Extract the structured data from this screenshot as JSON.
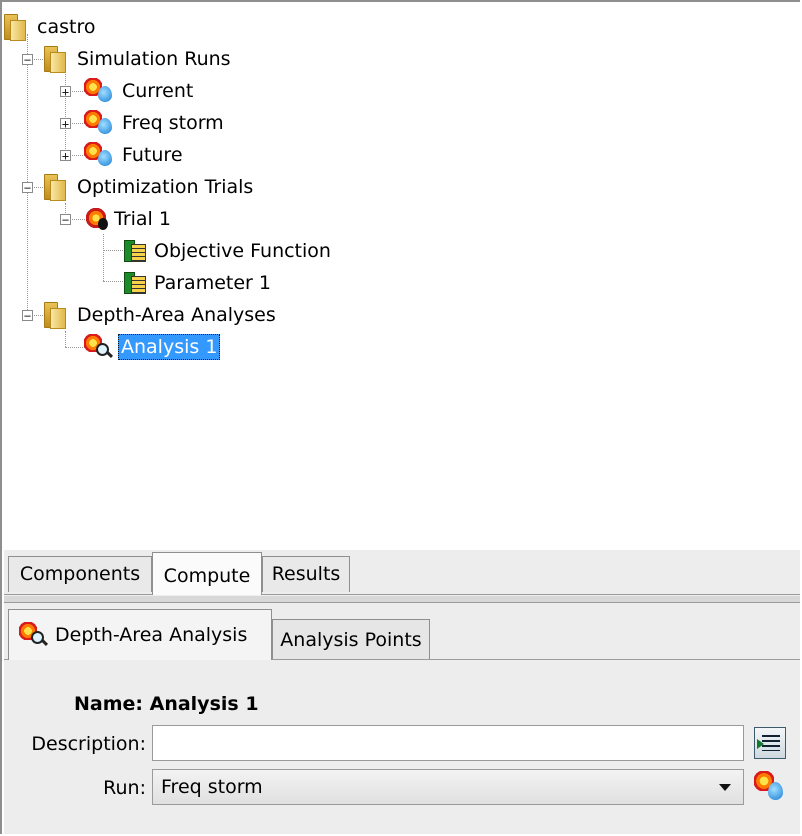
{
  "tree": {
    "root": {
      "label": "castro"
    },
    "simulation_runs": {
      "label": "Simulation Runs",
      "items": [
        {
          "label": "Current"
        },
        {
          "label": "Freq storm"
        },
        {
          "label": "Future"
        }
      ]
    },
    "optimization_trials": {
      "label": "Optimization Trials",
      "trial": {
        "label": "Trial 1",
        "children": [
          {
            "label": "Objective Function"
          },
          {
            "label": "Parameter 1"
          }
        ]
      }
    },
    "depth_area_analyses": {
      "label": "Depth-Area Analyses",
      "items": [
        {
          "label": "Analysis 1",
          "selected": true
        }
      ]
    },
    "expander_collapsed": "+",
    "expander_expanded": "−"
  },
  "tabs": [
    {
      "label": "Components",
      "active": false
    },
    {
      "label": "Compute",
      "active": true
    },
    {
      "label": "Results",
      "active": false
    }
  ],
  "property_tabs": [
    {
      "label": "Depth-Area Analysis",
      "active": true,
      "icon": "depth-area-analysis-icon"
    },
    {
      "label": "Analysis Points",
      "active": false
    }
  ],
  "form": {
    "name_label": "Name: Analysis 1",
    "description_label": "Description:",
    "description_value": "",
    "run_label": "Run:",
    "run_value": "Freq storm"
  },
  "colors": {
    "selection": "#3399ff",
    "panel_background": "#ededed"
  }
}
